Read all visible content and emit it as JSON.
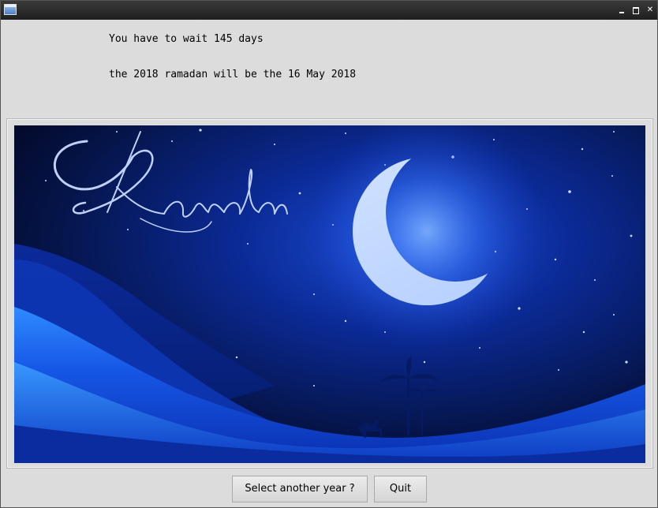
{
  "window": {
    "title": "",
    "controls": [
      "minimize",
      "maximize",
      "close"
    ]
  },
  "messages": {
    "wait": "You have to wait 145 days",
    "date": "the 2018 ramadan will be the 16 May 2018"
  },
  "image": {
    "logo_text": "Ramadan",
    "description_icons": [
      "crescent-moon",
      "stars",
      "desert-dunes",
      "palm-tree",
      "camel"
    ]
  },
  "buttons": {
    "select_year": "Select another year ?",
    "quit": "Quit"
  },
  "colors": {
    "window_bg": "#dcdcdc",
    "sky_dark": "#03082a",
    "sky_mid": "#0a2a8a",
    "dune_light": "#2d7bff"
  }
}
